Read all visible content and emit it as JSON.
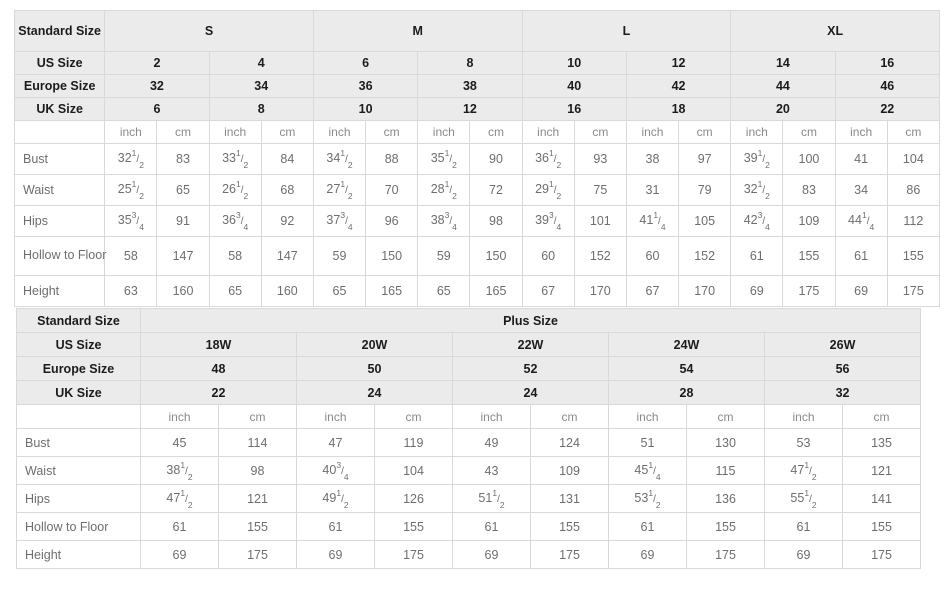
{
  "standard_table": {
    "corner_label": "Standard Size",
    "group_headers": [
      {
        "label": "S",
        "span": 4
      },
      {
        "label": "M",
        "span": 4
      },
      {
        "label": "L",
        "span": 4
      },
      {
        "label": "XL",
        "span": 4
      }
    ],
    "row_labels": {
      "us": "US Size",
      "europe": "Europe Size",
      "uk": "UK Size"
    },
    "us_sizes": [
      "2",
      "4",
      "6",
      "8",
      "10",
      "12",
      "14",
      "16"
    ],
    "europe_sizes": [
      "32",
      "34",
      "36",
      "38",
      "40",
      "42",
      "44",
      "46"
    ],
    "uk_sizes": [
      "6",
      "8",
      "10",
      "12",
      "16",
      "18",
      "20",
      "22"
    ],
    "unit_inch": "inch",
    "unit_cm": "cm",
    "measurements": [
      {
        "label": "Bust",
        "inch": [
          "32 1/2",
          "33 1/2",
          "34 1/2",
          "35 1/2",
          "36 1/2",
          "38",
          "39 1/2",
          "41"
        ],
        "cm": [
          "83",
          "84",
          "88",
          "90",
          "93",
          "97",
          "100",
          "104"
        ]
      },
      {
        "label": "Waist",
        "inch": [
          "25 1/2",
          "26 1/2",
          "27 1/2",
          "28 1/2",
          "29 1/2",
          "31",
          "32 1/2",
          "34"
        ],
        "cm": [
          "65",
          "68",
          "70",
          "72",
          "75",
          "79",
          "83",
          "86"
        ]
      },
      {
        "label": "Hips",
        "inch": [
          "35 3/4",
          "36 3/4",
          "37 3/4",
          "38 3/4",
          "39 3/4",
          "41 1/4",
          "42 3/4",
          "44 1/4"
        ],
        "cm": [
          "91",
          "92",
          "96",
          "98",
          "101",
          "105",
          "109",
          "112"
        ]
      },
      {
        "label": "Hollow to Floor",
        "inch": [
          "58",
          "58",
          "59",
          "59",
          "60",
          "60",
          "61",
          "61"
        ],
        "cm": [
          "147",
          "147",
          "150",
          "150",
          "152",
          "152",
          "155",
          "155"
        ]
      },
      {
        "label": "Height",
        "inch": [
          "63",
          "65",
          "65",
          "65",
          "67",
          "67",
          "69",
          "69"
        ],
        "cm": [
          "160",
          "160",
          "165",
          "165",
          "170",
          "170",
          "175",
          "175"
        ]
      }
    ]
  },
  "plus_table": {
    "corner_label": "Standard Size",
    "group_header": "Plus Size",
    "row_labels": {
      "us": "US Size",
      "europe": "Europe Size",
      "uk": "UK Size"
    },
    "us_sizes": [
      "18W",
      "20W",
      "22W",
      "24W",
      "26W"
    ],
    "europe_sizes": [
      "48",
      "50",
      "52",
      "54",
      "56"
    ],
    "uk_sizes": [
      "22",
      "24",
      "24",
      "28",
      "32"
    ],
    "unit_inch": "inch",
    "unit_cm": "cm",
    "measurements": [
      {
        "label": "Bust",
        "inch": [
          "45",
          "47",
          "49",
          "51",
          "53"
        ],
        "cm": [
          "114",
          "119",
          "124",
          "130",
          "135"
        ]
      },
      {
        "label": "Waist",
        "inch": [
          "38 1/2",
          "40 3/4",
          "43",
          "45 1/4",
          "47 1/2"
        ],
        "cm": [
          "98",
          "104",
          "109",
          "115",
          "121"
        ]
      },
      {
        "label": "Hips",
        "inch": [
          "47 1/2",
          "49 1/2",
          "51 1/2",
          "53 1/2",
          "55 1/2"
        ],
        "cm": [
          "121",
          "126",
          "131",
          "136",
          "141"
        ]
      },
      {
        "label": "Hollow to Floor",
        "inch": [
          "61",
          "61",
          "61",
          "61",
          "61"
        ],
        "cm": [
          "155",
          "155",
          "155",
          "155",
          "155"
        ]
      },
      {
        "label": "Height",
        "inch": [
          "69",
          "69",
          "69",
          "69",
          "69"
        ],
        "cm": [
          "175",
          "175",
          "175",
          "175",
          "175"
        ]
      }
    ]
  },
  "colors": {
    "header_bg": "#ebebeb",
    "border": "#d9d9d9",
    "header_text": "#1c1c1c",
    "data_text": "#6e6e6e",
    "page_bg": "#ffffff"
  }
}
